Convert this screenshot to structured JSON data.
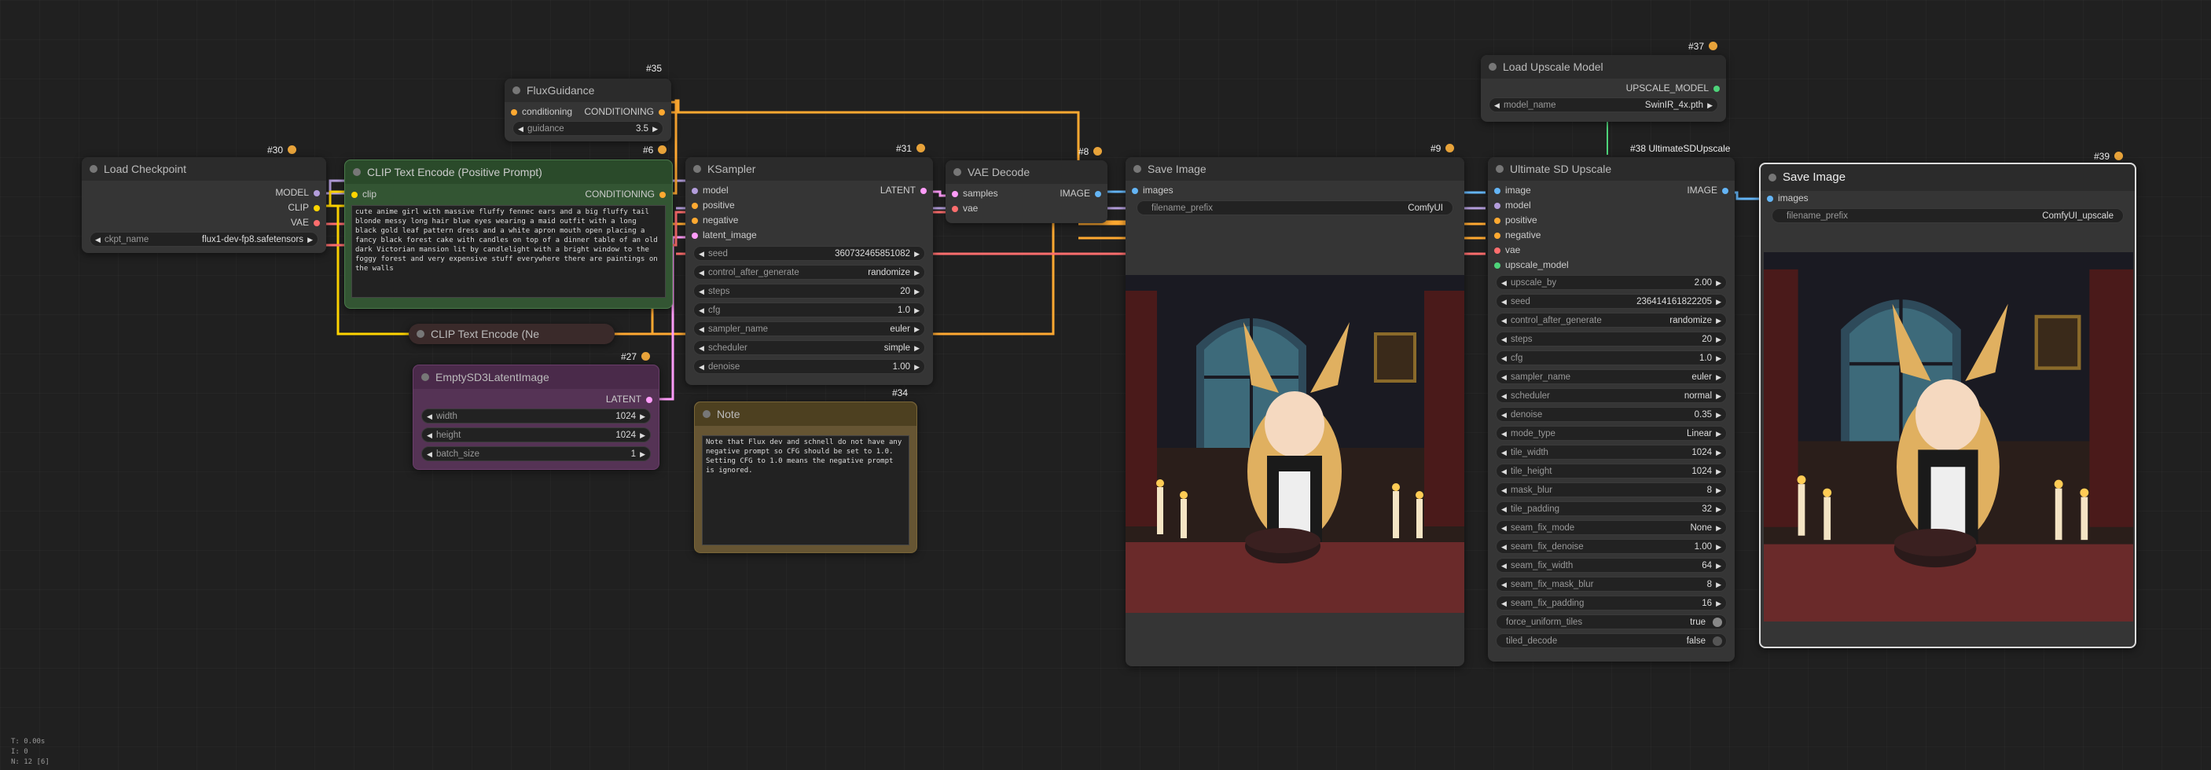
{
  "colors": {
    "model": "#b39ddb",
    "clip": "#ffd500",
    "vae": "#ff6e6e",
    "conditioning": "#ffa931",
    "latent": "#ff9cf9",
    "image": "#64b5f6",
    "upscale_model": "#4ed47a"
  },
  "load_checkpoint": {
    "id": "#30",
    "title": "Load Checkpoint",
    "outputs": [
      "MODEL",
      "CLIP",
      "VAE"
    ],
    "widget_label": "ckpt_name",
    "widget_value": "flux1-dev-fp8.safetensors"
  },
  "clip_pos": {
    "id": "#6",
    "title": "CLIP Text Encode (Positive Prompt)",
    "input": "clip",
    "output": "CONDITIONING",
    "text": "cute anime girl with massive fluffy fennec ears and a big fluffy tail blonde messy long hair blue eyes wearing a maid outfit with a long black gold leaf pattern dress and a white apron mouth open placing a fancy black forest cake with candles on top of a dinner table of an old dark Victorian mansion lit by candlelight with a bright window to the foggy forest and very expensive stuff everywhere there are paintings on the walls"
  },
  "clip_neg": {
    "title": "CLIP Text Encode (Ne"
  },
  "flux_guidance": {
    "id": "#35",
    "title": "FluxGuidance",
    "input": "conditioning",
    "output": "CONDITIONING",
    "widget_label": "guidance",
    "widget_value": "3.5"
  },
  "empty_latent": {
    "id": "#27",
    "title": "EmptySD3LatentImage",
    "output": "LATENT",
    "widgets": [
      {
        "label": "width",
        "value": "1024"
      },
      {
        "label": "height",
        "value": "1024"
      },
      {
        "label": "batch_size",
        "value": "1"
      }
    ]
  },
  "ksampler": {
    "id": "#31",
    "title": "KSampler",
    "inputs": [
      "model",
      "positive",
      "negative",
      "latent_image"
    ],
    "output": "LATENT",
    "widgets": [
      {
        "label": "seed",
        "value": "360732465851082"
      },
      {
        "label": "control_after_generate",
        "value": "randomize"
      },
      {
        "label": "steps",
        "value": "20"
      },
      {
        "label": "cfg",
        "value": "1.0"
      },
      {
        "label": "sampler_name",
        "value": "euler"
      },
      {
        "label": "scheduler",
        "value": "simple"
      },
      {
        "label": "denoise",
        "value": "1.00"
      }
    ]
  },
  "note": {
    "id": "#34",
    "title": "Note",
    "text": "Note that Flux dev and schnell do not have any negative prompt so CFG should be set to 1.0. Setting CFG to 1.0 means the negative prompt is ignored."
  },
  "vae_decode": {
    "id": "#8",
    "title": "VAE Decode",
    "inputs": [
      "samples",
      "vae"
    ],
    "output": "IMAGE"
  },
  "save_image_1": {
    "id": "#9",
    "title": "Save Image",
    "input": "images",
    "widget_label": "filename_prefix",
    "widget_value": "ComfyUI"
  },
  "load_upscale": {
    "id": "#37",
    "title": "Load Upscale Model",
    "output": "UPSCALE_MODEL",
    "widget_label": "model_name",
    "widget_value": "SwinIR_4x.pth"
  },
  "ultimate_sd": {
    "id": "#38",
    "badge_text": "UltimateSDUpscale",
    "title": "Ultimate SD Upscale",
    "inputs": [
      "image",
      "model",
      "positive",
      "negative",
      "vae",
      "upscale_model"
    ],
    "output": "IMAGE",
    "widgets": [
      {
        "label": "upscale_by",
        "value": "2.00"
      },
      {
        "label": "seed",
        "value": "236414161822205"
      },
      {
        "label": "control_after_generate",
        "value": "randomize"
      },
      {
        "label": "steps",
        "value": "20"
      },
      {
        "label": "cfg",
        "value": "1.0"
      },
      {
        "label": "sampler_name",
        "value": "euler"
      },
      {
        "label": "scheduler",
        "value": "normal"
      },
      {
        "label": "denoise",
        "value": "0.35"
      },
      {
        "label": "mode_type",
        "value": "Linear"
      },
      {
        "label": "tile_width",
        "value": "1024"
      },
      {
        "label": "tile_height",
        "value": "1024"
      },
      {
        "label": "mask_blur",
        "value": "8"
      },
      {
        "label": "tile_padding",
        "value": "32"
      },
      {
        "label": "seam_fix_mode",
        "value": "None"
      },
      {
        "label": "seam_fix_denoise",
        "value": "1.00"
      },
      {
        "label": "seam_fix_width",
        "value": "64"
      },
      {
        "label": "seam_fix_mask_blur",
        "value": "8"
      },
      {
        "label": "seam_fix_padding",
        "value": "16"
      }
    ],
    "toggles": [
      {
        "label": "force_uniform_tiles",
        "value": "true"
      },
      {
        "label": "tiled_decode",
        "value": "false"
      }
    ]
  },
  "save_image_2": {
    "id": "#39",
    "title": "Save Image",
    "input": "images",
    "widget_label": "filename_prefix",
    "widget_value": "ComfyUI_upscale"
  },
  "stats": {
    "t": "T: 0.00s",
    "i": "I: 0",
    "n": "N: 12 [6]"
  }
}
